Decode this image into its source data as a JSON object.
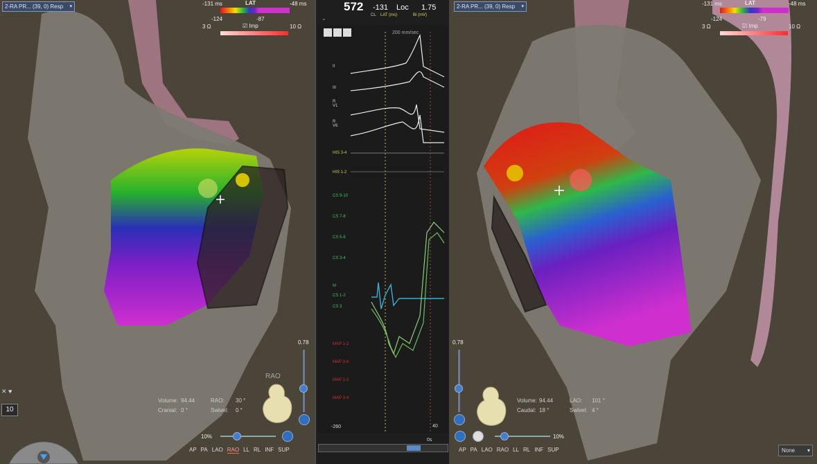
{
  "map_selector": {
    "label": "2-RA PR... (39, 0) Resp",
    "chevron": "chevron-down-icon"
  },
  "lat_legend": {
    "min": "-131 ms",
    "title": "LAT",
    "max": "-48 ms"
  },
  "left_view": {
    "lat_low": "-124",
    "lat_high": "-87",
    "imp_min": "3 Ω",
    "imp_label": "Imp",
    "imp_max": "10 Ω",
    "opacity": "0.78",
    "orientation_label": "RAO",
    "volume_label": "Volume:",
    "volume_value": "94.44",
    "angle1_label": "RAO:",
    "angle1_value": "30 °",
    "angle2_label": "Cranial:",
    "angle2_value": "0 °",
    "angle3_label": "Swivel:",
    "angle3_value": "0 °",
    "zoom": "10%",
    "view_buttons": [
      "AP",
      "PA",
      "LAO",
      "RAO",
      "LL",
      "RL",
      "INF",
      "SUP"
    ],
    "active_view": "RAO",
    "side_counter": "10"
  },
  "right_view": {
    "lat_low": "-124",
    "lat_high": "-79",
    "imp_min": "3 Ω",
    "imp_label": "Imp",
    "imp_max": "10 Ω",
    "opacity": "0.78",
    "volume_label": "Volume:",
    "volume_value": "94.44",
    "angle1_label": "LAO:",
    "angle1_value": "101 °",
    "angle2_label": "Caudal:",
    "angle2_value": "18 °",
    "angle3_label": "Swivel:",
    "angle3_value": "4 °",
    "zoom": "10%",
    "view_buttons": [
      "AP",
      "PA",
      "LAO",
      "RAO",
      "LL",
      "RL",
      "INF",
      "SUP"
    ],
    "dropdown": "None"
  },
  "center_panel": {
    "cl_value": "572",
    "cl_label": "CL",
    "lat_value": "-131",
    "lat_label": "LAT (ms)",
    "loc_label": "Loc",
    "bi_value": "1.75",
    "bi_label": "Bi (mV)",
    "sweep_speed": "200 mm/sec",
    "trace_labels": [
      "II",
      "III",
      "R V1",
      "R V6",
      "HIS 3-4",
      "HIS 1-2",
      "CS 9-10",
      "CS 7-8",
      "CS 5-6",
      "CS 3-4",
      "M",
      "CS 1-2",
      "CS 3",
      "MAP 1-2",
      "MAP 3-4",
      "MAP 1-2",
      "MAP 3-4"
    ],
    "scale_left": "-260",
    "scale_right": "40",
    "time_label": "0s"
  },
  "colors": {
    "lat_purple": "#d02fd0",
    "lat_red": "#e01818",
    "imp_red": "#ff2a2a",
    "accent_blue": "#3e7fd0"
  }
}
